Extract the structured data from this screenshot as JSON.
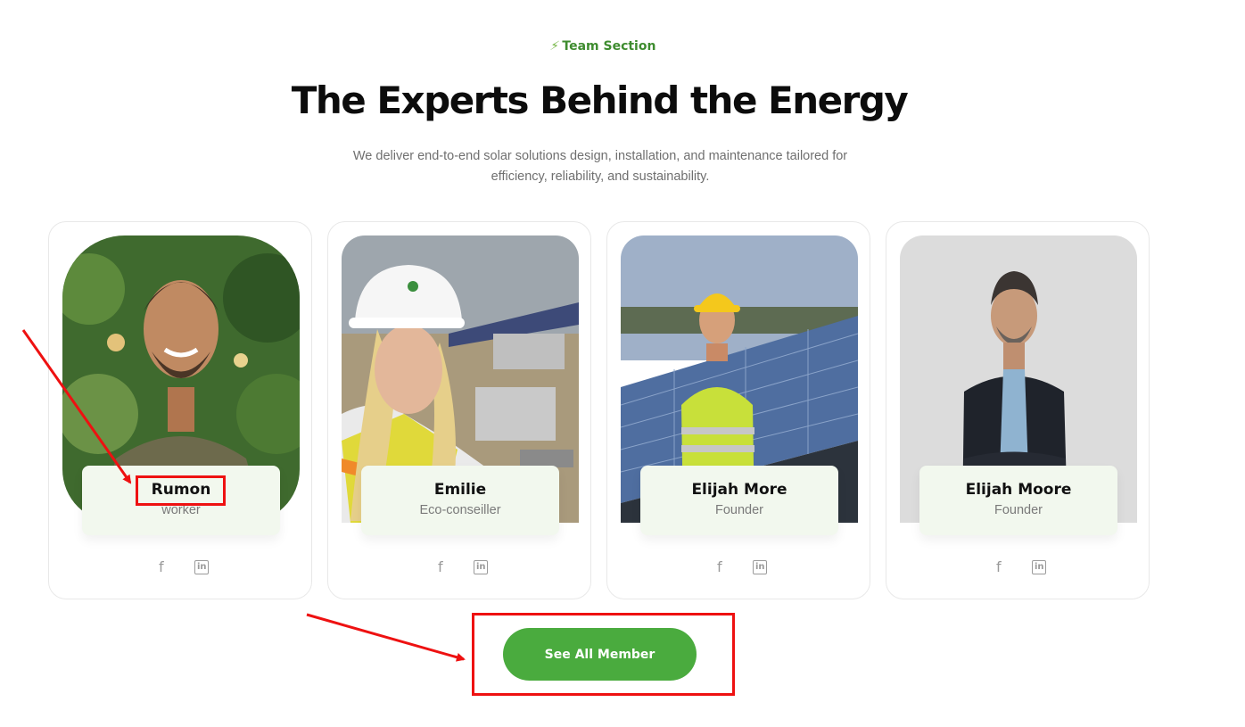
{
  "section": {
    "eyebrow": "Team Section",
    "title": "The Experts Behind the Energy",
    "description": "We deliver end-to-end solar solutions design, installation, and maintenance tailored for efficiency, reliability, and sustainability."
  },
  "members": [
    {
      "name": "Rumon",
      "role": "worker"
    },
    {
      "name": "Emilie",
      "role": "Eco-conseiller"
    },
    {
      "name": "Elijah More",
      "role": "Founder"
    },
    {
      "name": "Elijah Moore",
      "role": "Founder"
    }
  ],
  "social": {
    "facebook_glyph": "f",
    "linkedin_glyph": "in"
  },
  "cta": {
    "label": "See All Member"
  },
  "colors": {
    "accent": "#4aab3e",
    "eyebrow": "#3e8c2f",
    "name_box": "#f2f8ee",
    "annotation": "#ee1111"
  },
  "icons": [
    "bolt-icon",
    "facebook-icon",
    "linkedin-icon"
  ]
}
